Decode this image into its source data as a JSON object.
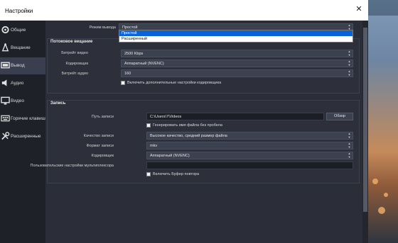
{
  "window": {
    "title": "Настройки",
    "close_glyph": "✕"
  },
  "sidebar": {
    "items": [
      {
        "label": "Общие",
        "icon": "gear-icon",
        "active": false
      },
      {
        "label": "Вещание",
        "icon": "broadcast-icon",
        "active": false
      },
      {
        "label": "Вывод",
        "icon": "output-icon",
        "active": true
      },
      {
        "label": "Аудио",
        "icon": "speaker-icon",
        "active": false
      },
      {
        "label": "Видео",
        "icon": "monitor-icon",
        "active": false
      },
      {
        "label": "Горячие клавиши",
        "icon": "keyboard-icon",
        "active": false
      },
      {
        "label": "Расширенные",
        "icon": "tools-icon",
        "active": false
      }
    ]
  },
  "output_mode": {
    "label": "Режим вывода",
    "value": "Простой",
    "options": [
      {
        "label": "Простой",
        "selected": true
      },
      {
        "label": "Расширенный",
        "selected": false
      }
    ]
  },
  "streaming": {
    "title": "Потоковое вещание",
    "video_bitrate": {
      "label": "Битрейт видео",
      "value": "2500 Kbps"
    },
    "encoder": {
      "label": "Кодировщик",
      "value": "Аппаратный (NVENC)"
    },
    "audio_bitrate": {
      "label": "Битрейт аудио",
      "value": "160"
    },
    "advanced_checkbox": {
      "label": "Включить дополнительные настройки кодировщика",
      "checked": false
    }
  },
  "recording": {
    "title": "Запись",
    "path": {
      "label": "Путь записи",
      "value": "C:\\Users\\7\\Videos"
    },
    "browse_label": "Обзор",
    "nospace_checkbox": {
      "label": "Генерировать имя файла без пробела",
      "checked": false
    },
    "quality": {
      "label": "Качество записи",
      "value": "Высокое качество, средний размер файла"
    },
    "format": {
      "label": "Формат записи",
      "value": "mkv"
    },
    "encoder": {
      "label": "Кодировщик",
      "value": "Аппаратный (NVENC)"
    },
    "muxer": {
      "label": "Пользовательские настройки мультиплексора",
      "value": ""
    },
    "replay_checkbox": {
      "label": "Включить Буфер повтора",
      "checked": false
    }
  },
  "spin_glyphs": {
    "up": "▲",
    "down": "▼"
  }
}
